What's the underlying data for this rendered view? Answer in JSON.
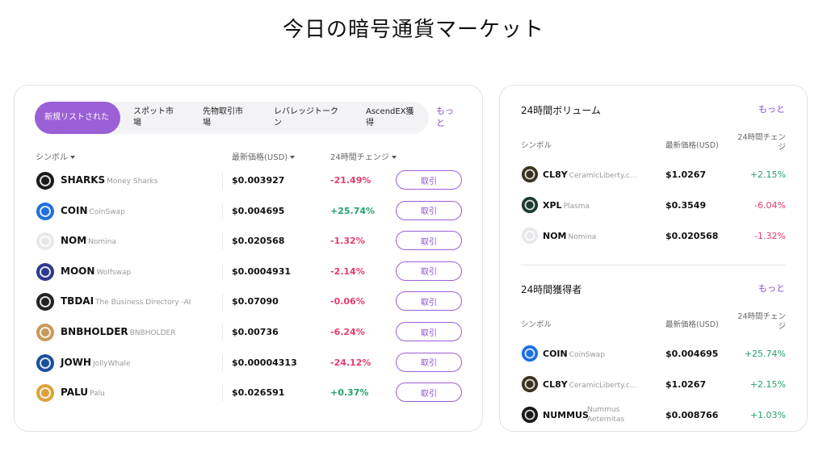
{
  "page": {
    "title": "今日の暗号通貨マーケット"
  },
  "main": {
    "tabs": [
      {
        "label": "新規リストされた",
        "active": true
      },
      {
        "label": "スポット市場",
        "active": false
      },
      {
        "label": "先物取引市場",
        "active": false
      },
      {
        "label": "レバレッジトークン",
        "active": false
      },
      {
        "label": "AscendEX獲得",
        "active": false
      }
    ],
    "more_label": "もっと",
    "columns": {
      "symbol": "シンボル",
      "price": "最新価格(USD)",
      "change": "24時間チェンジ"
    },
    "trade_label": "取引",
    "rows": [
      {
        "symbol": "SHARKS",
        "name": "Money Sharks",
        "price": "$0.003927",
        "change": "-21.49%",
        "direction": "down",
        "icon": "shark-logo",
        "color": "#1a1a1a"
      },
      {
        "symbol": "COIN",
        "name": "CoinSwap",
        "price": "$0.004695",
        "change": "+25.74%",
        "direction": "up",
        "icon": "coinswap-logo",
        "color": "#1f6fe0"
      },
      {
        "symbol": "NOM",
        "name": "Nomina",
        "price": "$0.020568",
        "change": "-1.32%",
        "direction": "down",
        "icon": "nomina-logo",
        "color": "#e8e8ec"
      },
      {
        "symbol": "MOON",
        "name": "Wolfswap",
        "price": "$0.0004931",
        "change": "-2.14%",
        "direction": "down",
        "icon": "wolf-logo",
        "color": "#2b3a8c"
      },
      {
        "symbol": "TBDAI",
        "name": "The Business Directory -AI",
        "price": "$0.07090",
        "change": "-0.06%",
        "direction": "down",
        "icon": "tbdai-logo",
        "color": "#222222"
      },
      {
        "symbol": "BNBHOLDER",
        "name": "BNBHOLDER",
        "price": "$0.00736",
        "change": "-6.24%",
        "direction": "down",
        "icon": "bnbholder-logo",
        "color": "#c89a5a"
      },
      {
        "symbol": "JOWH",
        "name": "JollyWhale",
        "price": "$0.00004313",
        "change": "-24.12%",
        "direction": "down",
        "icon": "whale-logo",
        "color": "#1b4f9c"
      },
      {
        "symbol": "PALU",
        "name": "Palu",
        "price": "$0.026591",
        "change": "+0.37%",
        "direction": "up",
        "icon": "palu-logo",
        "color": "#d9a23a"
      }
    ]
  },
  "side": {
    "volume": {
      "title": "24時間ボリューム",
      "more_label": "もっと",
      "columns": {
        "symbol": "シンボル",
        "price": "最新価格(USD)",
        "change": "24時間チェンジ"
      },
      "rows": [
        {
          "symbol": "CL8Y",
          "name": "CeramicLiberty.c...",
          "price": "$1.0267",
          "change": "+2.15%",
          "direction": "up",
          "icon": "cl8y-logo",
          "color": "#3a3320"
        },
        {
          "symbol": "XPL",
          "name": "Plasma",
          "price": "$0.3549",
          "change": "-6.04%",
          "direction": "down",
          "icon": "plasma-logo",
          "color": "#1e3b34"
        },
        {
          "symbol": "NOM",
          "name": "Nomina",
          "price": "$0.020568",
          "change": "-1.32%",
          "direction": "down",
          "icon": "nomina-logo",
          "color": "#e8e8ec"
        }
      ]
    },
    "gainers": {
      "title": "24時間獲得者",
      "more_label": "もっと",
      "columns": {
        "symbol": "シンボル",
        "price": "最新価格(USD)",
        "change": "24時間チェンジ"
      },
      "rows": [
        {
          "symbol": "COIN",
          "name": "CoinSwap",
          "price": "$0.004695",
          "change": "+25.74%",
          "direction": "up",
          "icon": "coinswap-logo",
          "color": "#1f6fe0"
        },
        {
          "symbol": "CL8Y",
          "name": "CeramicLiberty.c...",
          "price": "$1.0267",
          "change": "+2.15%",
          "direction": "up",
          "icon": "cl8y-logo",
          "color": "#3a3320"
        },
        {
          "symbol": "NUMMUS",
          "name": "Nummus Aeternitas",
          "price": "$0.008766",
          "change": "+1.03%",
          "direction": "up",
          "icon": "nummus-logo",
          "color": "#1a1a1a"
        }
      ]
    }
  }
}
